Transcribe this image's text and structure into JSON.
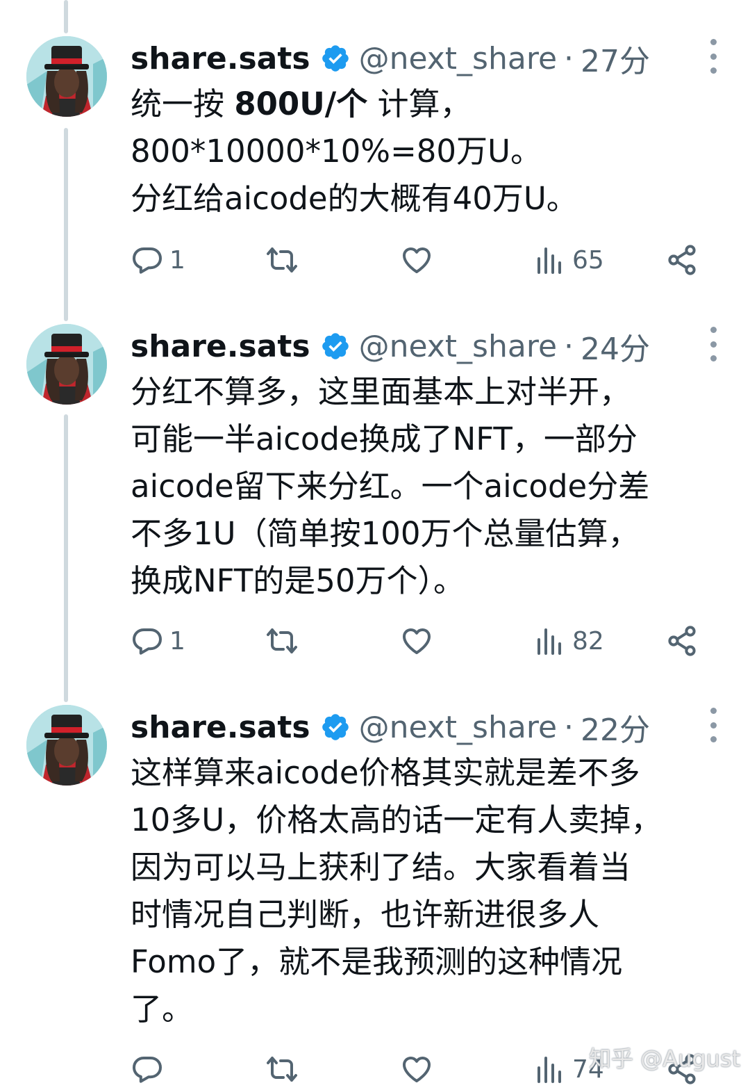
{
  "tweets": [
    {
      "name": "share.sats",
      "handle": "@next_share",
      "separator": "·",
      "time": "27分",
      "text_lines": [
        {
          "pre": "统一按 ",
          "bold": "800U/个",
          "post": " 计算，"
        },
        {
          "pre": "800*10000*10%=80万U。",
          "bold": "",
          "post": ""
        },
        {
          "pre": "分红给aicode的大概有40万U。",
          "bold": "",
          "post": ""
        }
      ],
      "replies": "1",
      "retweets": "",
      "likes": "",
      "views": "65"
    },
    {
      "name": "share.sats",
      "handle": "@next_share",
      "separator": "·",
      "time": "24分",
      "text_lines": [
        {
          "pre": "分红不算多，这里面基本上对半开，",
          "bold": "",
          "post": ""
        },
        {
          "pre": "可能一半aicode换成了NFT，一部分",
          "bold": "",
          "post": ""
        },
        {
          "pre": "aicode留下来分红。一个aicode分差",
          "bold": "",
          "post": ""
        },
        {
          "pre": "不多1U（简单按100万个总量估算，",
          "bold": "",
          "post": ""
        },
        {
          "pre": "换成NFT的是50万个）。",
          "bold": "",
          "post": ""
        }
      ],
      "replies": "1",
      "retweets": "",
      "likes": "",
      "views": "82"
    },
    {
      "name": "share.sats",
      "handle": "@next_share",
      "separator": "·",
      "time": "22分",
      "text_lines": [
        {
          "pre": "这样算来aicode价格其实就是差不多",
          "bold": "",
          "post": ""
        },
        {
          "pre": "10多U，价格太高的话一定有人卖掉，",
          "bold": "",
          "post": ""
        },
        {
          "pre": "因为可以马上获利了结。大家看着当",
          "bold": "",
          "post": ""
        },
        {
          "pre": "时情况自己判断，也许新进很多人",
          "bold": "",
          "post": ""
        },
        {
          "pre": "Fomo了，就不是我预测的这种情况",
          "bold": "",
          "post": ""
        },
        {
          "pre": "了。",
          "bold": "",
          "post": ""
        }
      ],
      "replies": "",
      "retweets": "",
      "likes": "",
      "views": "74"
    }
  ],
  "watermark": "知乎 @August",
  "icons": {
    "reply": "reply-icon",
    "retweet": "retweet-icon",
    "like": "heart-icon",
    "views": "views-icon",
    "share": "share-icon",
    "verified": "verified-badge-icon",
    "more": "more-icon"
  },
  "colors": {
    "verified": "#1d9bf0",
    "muted": "#536471",
    "thread_line": "#cfd9de"
  }
}
